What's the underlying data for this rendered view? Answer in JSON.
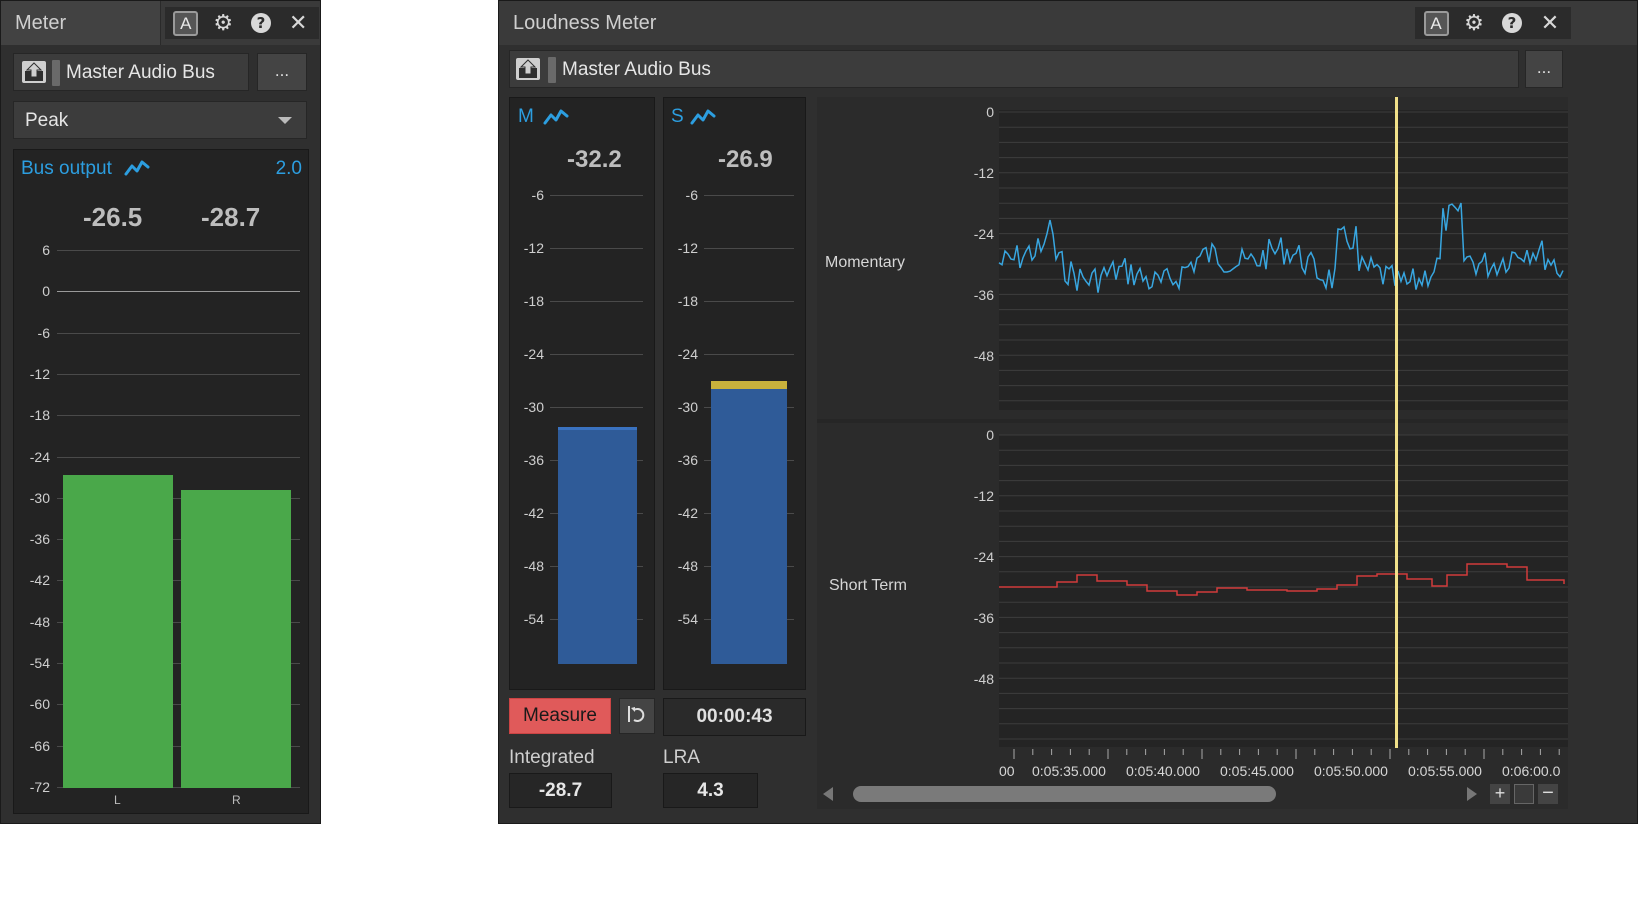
{
  "meter": {
    "title": "Meter",
    "bus_label": "Master Audio Bus",
    "more_label": "...",
    "mode": "Peak",
    "bus_output_label": "Bus output",
    "channels_label": "2.0",
    "left_value": "-26.5",
    "right_value": "-28.7",
    "ticks": [
      "6",
      "0",
      "-6",
      "-12",
      "-18",
      "-24",
      "-30",
      "-36",
      "-42",
      "-48",
      "-54",
      "-60",
      "-66",
      "-72"
    ],
    "channel_left": "L",
    "channel_right": "R",
    "bar_color": "#4aa84a"
  },
  "loudness": {
    "title": "Loudness Meter",
    "bus_label": "Master Audio Bus",
    "more_label": "...",
    "m_label": "M",
    "s_label": "S",
    "m_value": "-32.2",
    "s_value": "-26.9",
    "meter_ticks": [
      "-6",
      "-12",
      "-18",
      "-24",
      "-30",
      "-36",
      "-42",
      "-48",
      "-54"
    ],
    "measure_label": "Measure",
    "elapsed": "00:00:43",
    "integrated_label": "Integrated",
    "integrated_value": "-28.7",
    "lra_label": "LRA",
    "lra_value": "4.3",
    "momentary_label": "Momentary",
    "short_term_label": "Short Term",
    "graph_ticks": [
      "0",
      "-12",
      "-24",
      "-36",
      "-48"
    ],
    "timeline": [
      "00",
      "0:05:35.000",
      "0:05:40.000",
      "0:05:45.000",
      "0:05:50.000",
      "0:05:55.000",
      "0:06:00.0"
    ],
    "bar_color": "#2f5b98",
    "momentary_color": "#38a6e0",
    "short_term_color": "#d23b3b",
    "cursor_color": "#f0e08a"
  },
  "icons": [
    "a-icon",
    "gear-icon",
    "help-icon",
    "close-icon",
    "bus-icon",
    "trend-icon",
    "reset-icon"
  ]
}
